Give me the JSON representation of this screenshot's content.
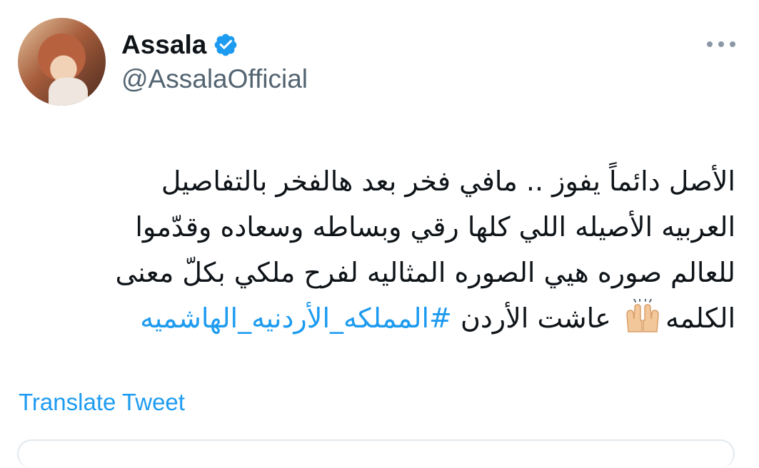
{
  "author": {
    "display_name": "Assala",
    "handle": "@AssalaOfficial",
    "verified": true
  },
  "tweet": {
    "lines": [
      "الأصل دائماً يفوز .. مافي فخر بعد هالفخر بالتفاصيل",
      "العربيه الأصيله اللي كلها رقي وبساطه وسعاده وقدّموا",
      "للعالم صوره هيي الصوره المثاليه لفرح ملكي بكلّ معنى"
    ],
    "last_line_prefix": "الكلمه",
    "emoji": "raising-hands-emoji",
    "last_line_text": "عاشت الأردن",
    "hashtag": "#المملكه_الأردنيه_الهاشميه"
  },
  "actions": {
    "translate_label": "Translate Tweet"
  },
  "icons": {
    "verified": "verified-badge-icon",
    "more": "more-options-icon"
  },
  "colors": {
    "link": "#1d9bf0",
    "secondary_text": "#536471",
    "primary_text": "#0f1419"
  }
}
